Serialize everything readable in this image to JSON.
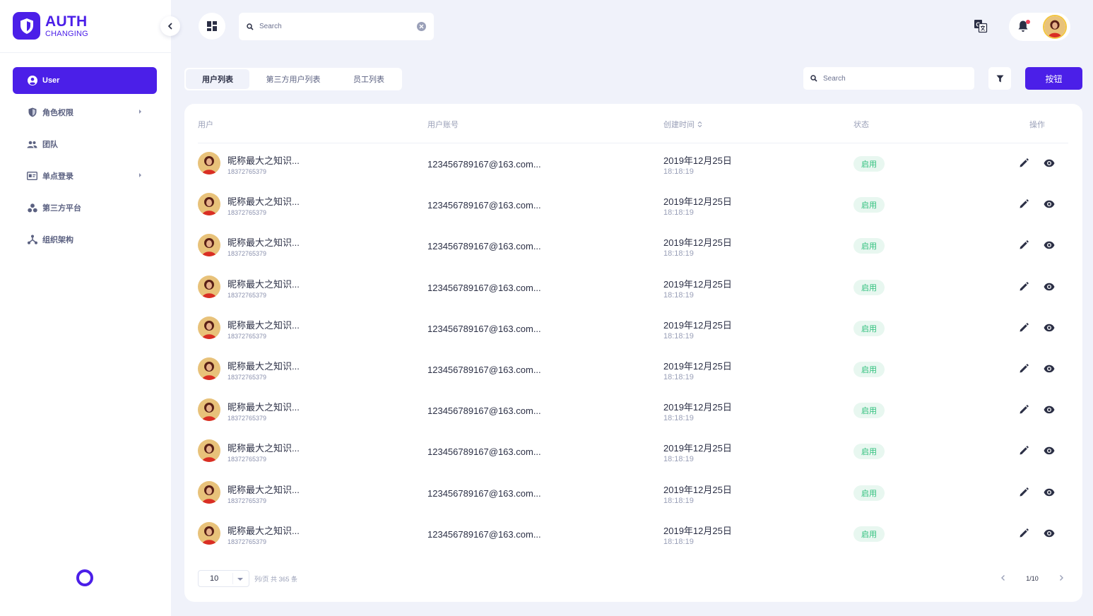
{
  "brand": {
    "title": "AUTH",
    "subtitle": "CHANGING"
  },
  "sidebar": {
    "items": [
      {
        "label": "User"
      },
      {
        "label": "角色权限"
      },
      {
        "label": "团队"
      },
      {
        "label": "单点登录"
      },
      {
        "label": "第三方平台"
      },
      {
        "label": "组织架构"
      }
    ]
  },
  "topbar": {
    "search_placeholder": "Search"
  },
  "tabs": [
    {
      "label": "用户列表"
    },
    {
      "label": "第三方用户列表"
    },
    {
      "label": "员工列表"
    }
  ],
  "toolbar": {
    "search_placeholder": "Search",
    "button_label": "按钮"
  },
  "table": {
    "columns": {
      "user": "用户",
      "account": "用户账号",
      "created": "创建时间",
      "status": "状态",
      "actions": "操作"
    },
    "rows": [
      {
        "name": "昵称最大之知识...",
        "phone": "18372765379",
        "account": "123456789167@163.com...",
        "date": "2019年12月25日",
        "time": "18:18:19",
        "status": "启用"
      },
      {
        "name": "昵称最大之知识...",
        "phone": "18372765379",
        "account": "123456789167@163.com...",
        "date": "2019年12月25日",
        "time": "18:18:19",
        "status": "启用"
      },
      {
        "name": "昵称最大之知识...",
        "phone": "18372765379",
        "account": "123456789167@163.com...",
        "date": "2019年12月25日",
        "time": "18:18:19",
        "status": "启用"
      },
      {
        "name": "昵称最大之知识...",
        "phone": "18372765379",
        "account": "123456789167@163.com...",
        "date": "2019年12月25日",
        "time": "18:18:19",
        "status": "启用"
      },
      {
        "name": "昵称最大之知识...",
        "phone": "18372765379",
        "account": "123456789167@163.com...",
        "date": "2019年12月25日",
        "time": "18:18:19",
        "status": "启用"
      },
      {
        "name": "昵称最大之知识...",
        "phone": "18372765379",
        "account": "123456789167@163.com...",
        "date": "2019年12月25日",
        "time": "18:18:19",
        "status": "启用"
      },
      {
        "name": "昵称最大之知识...",
        "phone": "18372765379",
        "account": "123456789167@163.com...",
        "date": "2019年12月25日",
        "time": "18:18:19",
        "status": "启用"
      },
      {
        "name": "昵称最大之知识...",
        "phone": "18372765379",
        "account": "123456789167@163.com...",
        "date": "2019年12月25日",
        "time": "18:18:19",
        "status": "启用"
      },
      {
        "name": "昵称最大之知识...",
        "phone": "18372765379",
        "account": "123456789167@163.com...",
        "date": "2019年12月25日",
        "time": "18:18:19",
        "status": "启用"
      },
      {
        "name": "昵称最大之知识...",
        "phone": "18372765379",
        "account": "123456789167@163.com...",
        "date": "2019年12月25日",
        "time": "18:18:19",
        "status": "启用"
      }
    ]
  },
  "pagination": {
    "page_size": "10",
    "info": "列/页  共 365 条",
    "page": "1/10"
  },
  "colors": {
    "primary": "#4b1fe8",
    "status_green": "#2cbf7a",
    "background": "#f0f2fa"
  },
  "icons": [
    "shield-icon",
    "chevron-left-icon",
    "grid-icon",
    "search-icon",
    "clear-icon",
    "translate-icon",
    "bell-icon",
    "filter-icon",
    "sort-icon",
    "edit-icon",
    "eye-icon",
    "chevron-right-icon"
  ]
}
